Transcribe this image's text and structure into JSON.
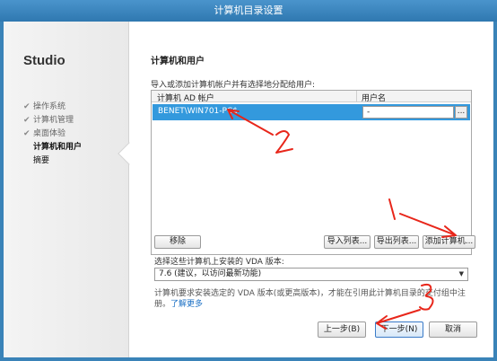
{
  "window": {
    "title": "计算机目录设置"
  },
  "sidebar": {
    "brand": "Studio",
    "steps": [
      {
        "label": "操作系统",
        "state": "done"
      },
      {
        "label": "计算机管理",
        "state": "done"
      },
      {
        "label": "桌面体验",
        "state": "done"
      },
      {
        "label": "计算机和用户",
        "state": "active"
      },
      {
        "label": "摘要",
        "state": "pending"
      }
    ],
    "check_glyph": "✔"
  },
  "main": {
    "title": "计算机和用户",
    "instruction": "导入或添加计算机帐户并有选择地分配给用户:",
    "table": {
      "columns": [
        "计算机 AD 帐户",
        "用户名"
      ],
      "rows": [
        {
          "account": "BENET\\WIN701-PC$",
          "user": "-",
          "browse_label": "..."
        }
      ]
    },
    "buttons": {
      "remove": "移除",
      "import": "导入列表...",
      "export": "导出列表...",
      "add": "添加计算机..."
    },
    "vda": {
      "label": "选择这些计算机上安装的 VDA 版本:",
      "selected": "7.6 (建议，以访问最新功能)",
      "caret": "▼"
    },
    "note": "计算机要求安装选定的 VDA 版本(或更高版本)，才能在引用此计算机目录的交付组中注册。",
    "note_link": "了解更多"
  },
  "footer": {
    "back": "上一步(B)",
    "next": "下一步(N)",
    "cancel": "取消"
  },
  "annotations": {
    "color": "#e8261a",
    "marks": [
      "1",
      "2",
      "3"
    ]
  }
}
